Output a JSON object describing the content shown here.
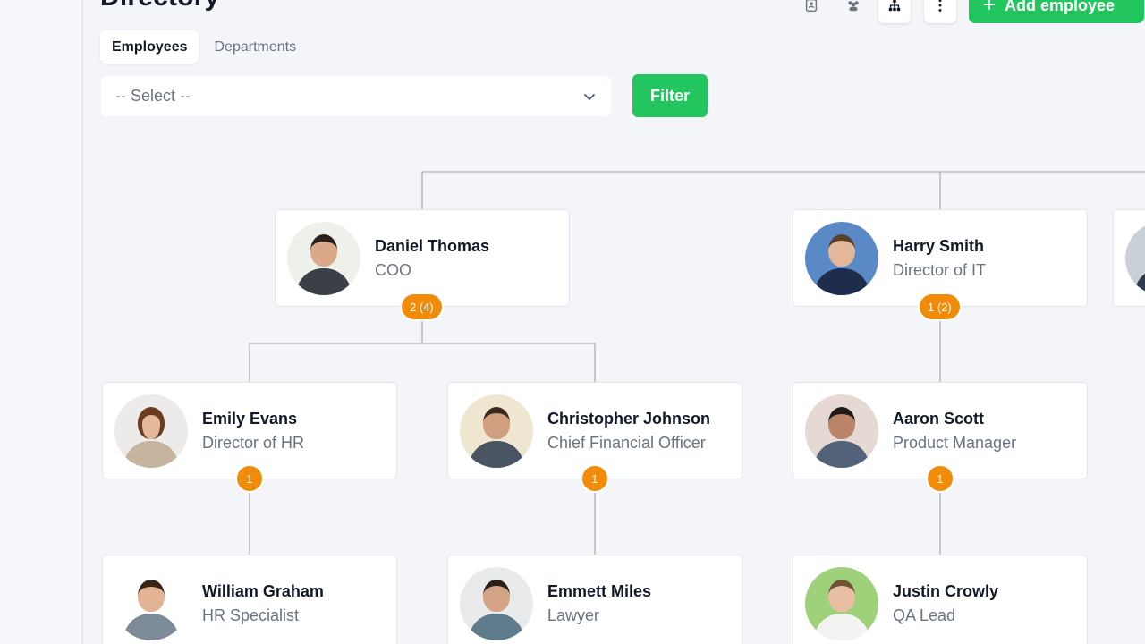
{
  "header": {
    "title": "Directory",
    "add_label": "Add employee",
    "add_icon": "plus-icon"
  },
  "toolbar": {
    "icons": [
      "contacts-icon",
      "team-icon",
      "org-chart-icon",
      "more-vertical-icon"
    ]
  },
  "tabs": [
    {
      "label": "Employees",
      "active": true
    },
    {
      "label": "Departments",
      "active": false
    }
  ],
  "filter": {
    "select_value": "-- Select --",
    "button_label": "Filter"
  },
  "colors": {
    "accent": "#22c55e",
    "badge": "#f28a0a",
    "connector": "#b8bec7"
  },
  "org": {
    "level1": [
      {
        "name": "Daniel Thomas",
        "role": "COO",
        "badge": "2 (4)"
      },
      {
        "name": "Harry Smith",
        "role": "Director of IT",
        "badge": "1 (2)"
      }
    ],
    "level2": [
      {
        "name": "Emily Evans",
        "role": "Director of HR",
        "badge": "1"
      },
      {
        "name": "Christopher Johnson",
        "role": "Chief Financial Officer",
        "badge": "1"
      },
      {
        "name": "Aaron Scott",
        "role": "Product Manager",
        "badge": "1"
      }
    ],
    "level3": [
      {
        "name": "William Graham",
        "role": "HR Specialist"
      },
      {
        "name": "Emmett Miles",
        "role": "Lawyer"
      },
      {
        "name": "Justin Crowly",
        "role": "QA Lead"
      }
    ]
  }
}
